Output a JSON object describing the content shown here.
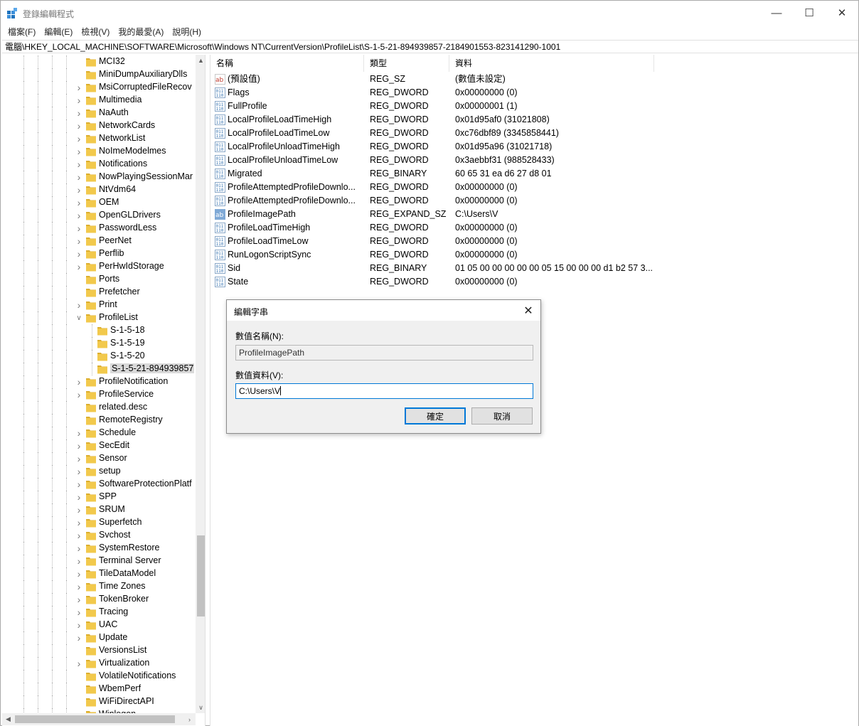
{
  "window": {
    "title": "登錄編輯程式",
    "minimize": "—",
    "maximize": "☐",
    "close": "✕"
  },
  "menu": [
    "檔案(F)",
    "編輯(E)",
    "檢視(V)",
    "我的最愛(A)",
    "說明(H)"
  ],
  "address": "電腦\\HKEY_LOCAL_MACHINE\\SOFTWARE\\Microsoft\\Windows NT\\CurrentVersion\\ProfileList\\S-1-5-21-894939857-2184901553-823141290-1001",
  "tree": {
    "items": [
      {
        "label": "MCI32",
        "level": 1,
        "exp": ""
      },
      {
        "label": "MiniDumpAuxiliaryDlls",
        "level": 1,
        "exp": ""
      },
      {
        "label": "MsiCorruptedFileRecov",
        "level": 1,
        "exp": ">"
      },
      {
        "label": "Multimedia",
        "level": 1,
        "exp": ">"
      },
      {
        "label": "NaAuth",
        "level": 1,
        "exp": ">"
      },
      {
        "label": "NetworkCards",
        "level": 1,
        "exp": ">"
      },
      {
        "label": "NetworkList",
        "level": 1,
        "exp": ">"
      },
      {
        "label": "NoImeModelmes",
        "level": 1,
        "exp": ">"
      },
      {
        "label": "Notifications",
        "level": 1,
        "exp": ">"
      },
      {
        "label": "NowPlayingSessionMar",
        "level": 1,
        "exp": ">"
      },
      {
        "label": "NtVdm64",
        "level": 1,
        "exp": ">"
      },
      {
        "label": "OEM",
        "level": 1,
        "exp": ">"
      },
      {
        "label": "OpenGLDrivers",
        "level": 1,
        "exp": ">"
      },
      {
        "label": "PasswordLess",
        "level": 1,
        "exp": ">"
      },
      {
        "label": "PeerNet",
        "level": 1,
        "exp": ">"
      },
      {
        "label": "Perflib",
        "level": 1,
        "exp": ">"
      },
      {
        "label": "PerHwIdStorage",
        "level": 1,
        "exp": ">"
      },
      {
        "label": "Ports",
        "level": 1,
        "exp": ""
      },
      {
        "label": "Prefetcher",
        "level": 1,
        "exp": ""
      },
      {
        "label": "Print",
        "level": 1,
        "exp": ">"
      },
      {
        "label": "ProfileList",
        "level": 1,
        "exp": "v"
      },
      {
        "label": "S-1-5-18",
        "level": 2,
        "exp": ""
      },
      {
        "label": "S-1-5-19",
        "level": 2,
        "exp": ""
      },
      {
        "label": "S-1-5-20",
        "level": 2,
        "exp": ""
      },
      {
        "label": "S-1-5-21-894939857",
        "level": 2,
        "exp": "",
        "selected": true
      },
      {
        "label": "ProfileNotification",
        "level": 1,
        "exp": ">"
      },
      {
        "label": "ProfileService",
        "level": 1,
        "exp": ">"
      },
      {
        "label": "related.desc",
        "level": 1,
        "exp": ""
      },
      {
        "label": "RemoteRegistry",
        "level": 1,
        "exp": ""
      },
      {
        "label": "Schedule",
        "level": 1,
        "exp": ">"
      },
      {
        "label": "SecEdit",
        "level": 1,
        "exp": ">"
      },
      {
        "label": "Sensor",
        "level": 1,
        "exp": ">"
      },
      {
        "label": "setup",
        "level": 1,
        "exp": ">"
      },
      {
        "label": "SoftwareProtectionPlatf",
        "level": 1,
        "exp": ">"
      },
      {
        "label": "SPP",
        "level": 1,
        "exp": ">"
      },
      {
        "label": "SRUM",
        "level": 1,
        "exp": ">"
      },
      {
        "label": "Superfetch",
        "level": 1,
        "exp": ">"
      },
      {
        "label": "Svchost",
        "level": 1,
        "exp": ">"
      },
      {
        "label": "SystemRestore",
        "level": 1,
        "exp": ">"
      },
      {
        "label": "Terminal Server",
        "level": 1,
        "exp": ">"
      },
      {
        "label": "TileDataModel",
        "level": 1,
        "exp": ">"
      },
      {
        "label": "Time Zones",
        "level": 1,
        "exp": ">"
      },
      {
        "label": "TokenBroker",
        "level": 1,
        "exp": ">"
      },
      {
        "label": "Tracing",
        "level": 1,
        "exp": ">"
      },
      {
        "label": "UAC",
        "level": 1,
        "exp": ">"
      },
      {
        "label": "Update",
        "level": 1,
        "exp": ">"
      },
      {
        "label": "VersionsList",
        "level": 1,
        "exp": ""
      },
      {
        "label": "Virtualization",
        "level": 1,
        "exp": ">"
      },
      {
        "label": "VolatileNotifications",
        "level": 1,
        "exp": ""
      },
      {
        "label": "WbemPerf",
        "level": 1,
        "exp": ""
      },
      {
        "label": "WiFiDirectAPI",
        "level": 1,
        "exp": ""
      },
      {
        "label": "Winlogon",
        "level": 1,
        "exp": ">"
      }
    ]
  },
  "list": {
    "columns": [
      "名稱",
      "類型",
      "資料"
    ],
    "rows": [
      {
        "icon": "string",
        "name": "(預設值)",
        "type": "REG_SZ",
        "data": "(數值未設定)"
      },
      {
        "icon": "binary",
        "name": "Flags",
        "type": "REG_DWORD",
        "data": "0x00000000 (0)"
      },
      {
        "icon": "binary",
        "name": "FullProfile",
        "type": "REG_DWORD",
        "data": "0x00000001 (1)"
      },
      {
        "icon": "binary",
        "name": "LocalProfileLoadTimeHigh",
        "type": "REG_DWORD",
        "data": "0x01d95af0 (31021808)"
      },
      {
        "icon": "binary",
        "name": "LocalProfileLoadTimeLow",
        "type": "REG_DWORD",
        "data": "0xc76dbf89 (3345858441)"
      },
      {
        "icon": "binary",
        "name": "LocalProfileUnloadTimeHigh",
        "type": "REG_DWORD",
        "data": "0x01d95a96 (31021718)"
      },
      {
        "icon": "binary",
        "name": "LocalProfileUnloadTimeLow",
        "type": "REG_DWORD",
        "data": "0x3aebbf31 (988528433)"
      },
      {
        "icon": "binary",
        "name": "Migrated",
        "type": "REG_BINARY",
        "data": "60 65 31 ea d6 27 d8 01"
      },
      {
        "icon": "binary",
        "name": "ProfileAttemptedProfileDownlo...",
        "type": "REG_DWORD",
        "data": "0x00000000 (0)"
      },
      {
        "icon": "binary",
        "name": "ProfileAttemptedProfileDownlo...",
        "type": "REG_DWORD",
        "data": "0x00000000 (0)"
      },
      {
        "icon": "string-selected",
        "name": "ProfileImagePath",
        "type": "REG_EXPAND_SZ",
        "data": "C:\\Users\\V"
      },
      {
        "icon": "binary",
        "name": "ProfileLoadTimeHigh",
        "type": "REG_DWORD",
        "data": "0x00000000 (0)"
      },
      {
        "icon": "binary",
        "name": "ProfileLoadTimeLow",
        "type": "REG_DWORD",
        "data": "0x00000000 (0)"
      },
      {
        "icon": "binary",
        "name": "RunLogonScriptSync",
        "type": "REG_DWORD",
        "data": "0x00000000 (0)"
      },
      {
        "icon": "binary",
        "name": "Sid",
        "type": "REG_BINARY",
        "data": "01 05 00 00 00 00 00 05 15 00 00 00 d1 b2 57 3..."
      },
      {
        "icon": "binary",
        "name": "State",
        "type": "REG_DWORD",
        "data": "0x00000000 (0)"
      }
    ]
  },
  "dialog": {
    "title": "編輯字串",
    "close": "✕",
    "name_label": "數值名稱(N):",
    "name_value": "ProfileImagePath",
    "data_label": "數值資料(V):",
    "data_value": "C:\\Users\\V",
    "ok": "確定",
    "cancel": "取消"
  },
  "colors": {
    "folder": "#f2c94c",
    "folder_dark": "#dcae2e",
    "focus": "#0078d7",
    "binary_icon": "#3c78b4",
    "string_icon": "#c0392b"
  }
}
